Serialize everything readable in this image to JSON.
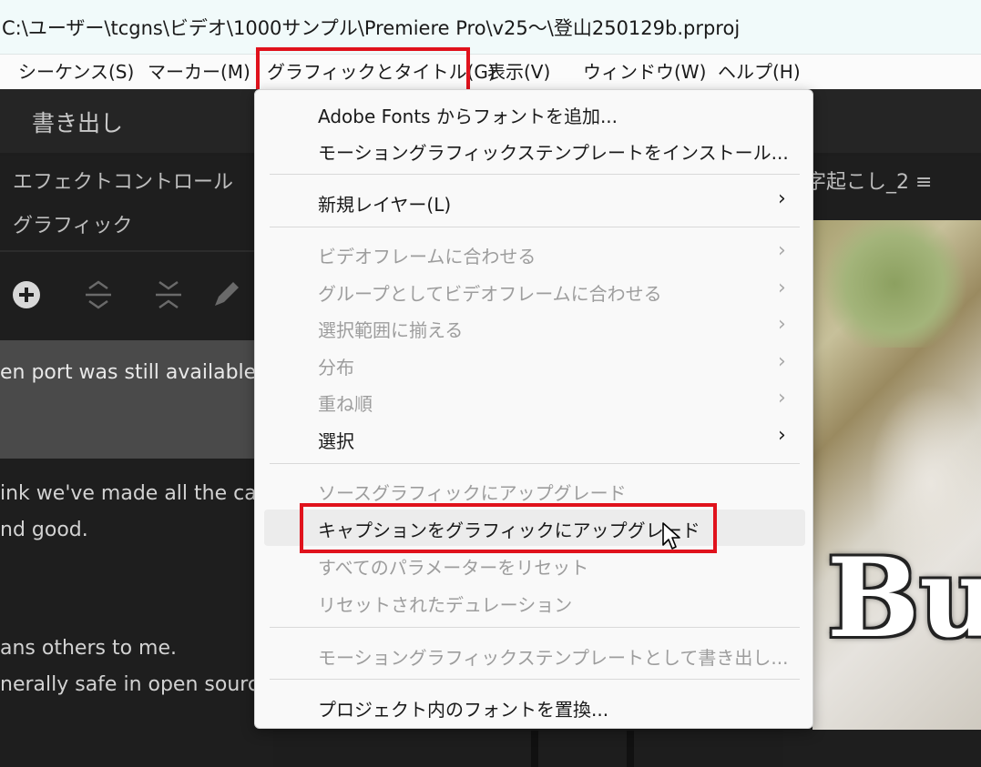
{
  "titlebar": {
    "path": "C:\\ユーザー\\tcgns\\ビデオ\\1000サンプル\\Premiere Pro\\v25～\\登山250129b.prproj"
  },
  "menubar": {
    "items": [
      {
        "label": "シーケンス(S)"
      },
      {
        "label": "マーカー(M)"
      },
      {
        "label": "グラフィックとタイトル(G)"
      },
      {
        "label": "表示(V)"
      },
      {
        "label": "ウィンドウ(W)"
      },
      {
        "label": "ヘルプ(H)"
      }
    ]
  },
  "toolbar": {
    "export_label": "書き出し"
  },
  "left_panel": {
    "tab_label": "エフェクトコントロール",
    "section_label": "グラフィック",
    "icons": [
      "add-circle-icon",
      "align-vertical-center-icon",
      "split-vertical-icon",
      "pencil-icon"
    ],
    "lines": [
      "en port was still available.",
      "ink we've made all the carg",
      "nd good.",
      "ans others to me.",
      "nerally safe in open source"
    ]
  },
  "right_panel": {
    "tab_label": "字起こし_2 ≡",
    "caption_text": "Bu"
  },
  "dropdown": {
    "items": [
      {
        "label": "Adobe Fonts からフォントを追加...",
        "disabled": false,
        "submenu": false
      },
      {
        "label": "モーショングラフィックステンプレートをインストール...",
        "disabled": false,
        "submenu": false
      },
      {
        "label": "新規レイヤー(L)",
        "disabled": false,
        "submenu": true
      },
      {
        "label": "ビデオフレームに合わせる",
        "disabled": true,
        "submenu": true
      },
      {
        "label": "グループとしてビデオフレームに合わせる",
        "disabled": true,
        "submenu": true
      },
      {
        "label": "選択範囲に揃える",
        "disabled": true,
        "submenu": true
      },
      {
        "label": "分布",
        "disabled": true,
        "submenu": true
      },
      {
        "label": "重ね順",
        "disabled": true,
        "submenu": true
      },
      {
        "label": "選択",
        "disabled": false,
        "submenu": true
      },
      {
        "label": "ソースグラフィックにアップグレード",
        "disabled": true,
        "submenu": false
      },
      {
        "label": "キャプションをグラフィックにアップグレード",
        "disabled": false,
        "submenu": false
      },
      {
        "label": "すべてのパラメーターをリセット",
        "disabled": true,
        "submenu": false
      },
      {
        "label": "リセットされたデュレーション",
        "disabled": true,
        "submenu": false
      },
      {
        "label": "モーショングラフィックステンプレートとして書き出し...",
        "disabled": true,
        "submenu": false
      },
      {
        "label": "プロジェクト内のフォントを置換...",
        "disabled": false,
        "submenu": false
      }
    ],
    "chevron": "›"
  },
  "colors": {
    "highlight_box": "#e0121c",
    "panel_bg": "#1d1d1d",
    "menu_bg": "#f9f9f9",
    "disabled_text": "#9d9d9d"
  }
}
